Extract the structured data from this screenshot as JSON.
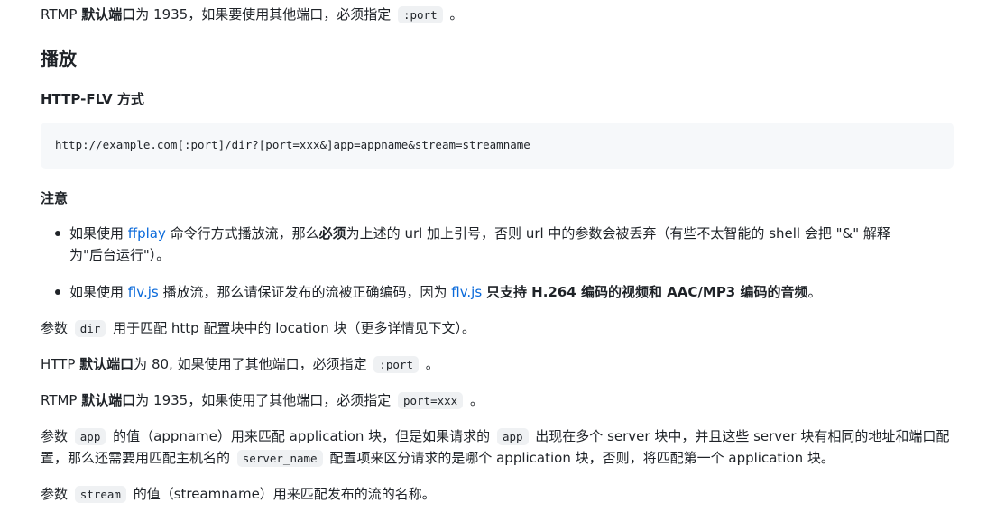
{
  "intro": {
    "line1": [
      "RTMP ",
      "默认端口",
      "为 1935，如果要使用其他端口，必须指定 ",
      ":port",
      " 。"
    ]
  },
  "play": {
    "heading": "播放",
    "subheading": "HTTP-FLV 方式",
    "code": "http://example.com[:port]/dir?[port=xxx&]app=appname&stream=streamname"
  },
  "notes": {
    "heading": "注意",
    "item1_line1": [
      "如果使用 ",
      "ffplay",
      " 命令行方式播放流，那么",
      "必须",
      "为上述的 url 加上引号，否则 url 中的参数会被丢弃（有些不太智能的 shell 会把 \"&\" 解释"
    ],
    "item1_line2": "为\"后台运行\"）。",
    "item2": [
      "如果使用 ",
      "flv.js",
      " 播放流，那么请保证发布的流被正确编码，因为 ",
      "flv.js",
      " ",
      "只支持 H.264 编码的视频和 AAC/MP3 编码的音频",
      "。"
    ]
  },
  "params": {
    "dir": [
      "参数 ",
      "dir",
      " 用于匹配 http 配置块中的 location 块（更多详情见下文）。"
    ],
    "http_port": [
      "HTTP ",
      "默认端口",
      "为 80, 如果使用了其他端口，必须指定 ",
      ":port",
      " 。"
    ],
    "rtmp_port": [
      "RTMP ",
      "默认端口",
      "为 1935，如果使用了其他端口，必须指定 ",
      "port=xxx",
      " 。"
    ],
    "app_line1": [
      "参数 ",
      "app",
      " 的值（appname）用来匹配 application 块，但是如果请求的 ",
      "app",
      " 出现在多个 server 块中，并且这些 server 块有相同的地址和端口配"
    ],
    "app_line2": [
      "置，那么还需要用匹配主机名的 ",
      "server_name",
      " 配置项来区分请求的是哪个 application 块，否则，将匹配第一个 application 块。"
    ],
    "stream": [
      "参数 ",
      "stream",
      " 的值（streamname）用来匹配发布的流的名称。"
    ]
  },
  "colors": {
    "text": "#1f2328",
    "link": "#0969da",
    "code_bg": "#eff1f3",
    "codeblock_bg": "#f6f8fa"
  }
}
